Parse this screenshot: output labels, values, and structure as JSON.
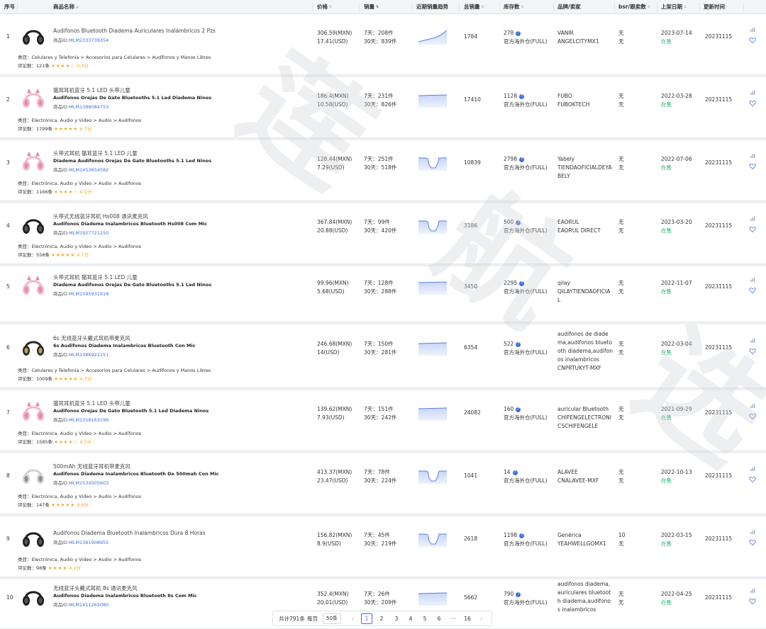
{
  "header": {
    "idx": "序号",
    "name": "商品名称",
    "price": "价格",
    "sales": "销量",
    "trend": "近期销量趋势",
    "total": "总销量",
    "stock": "库存数",
    "brand": "品牌/卖家",
    "bsr": "bsr/跟卖数",
    "date": "上架日期",
    "updated": "更新时间"
  },
  "products": [
    {
      "idx": "1",
      "title": "Audifonos Bluetooth Diadema Auriculares Inalámbricos 2 Pzs",
      "subtitle": "",
      "pid_label": "商品ID:",
      "pid": "MLM2333739354",
      "category": "类目：Celulares y Telefonía > Accesorios para Celulares > Audífonos y Manos Libres",
      "reviews": "评论数：121条",
      "stars": "★★★★☆",
      "rating": "4.4分",
      "price_mxn": "306.59(MXN)",
      "price_usd": "17.41(USD)",
      "sales7": "7天：208件",
      "sales30": "30天：839件",
      "trend": "up",
      "total": "1784",
      "stock": "278",
      "warehouse": "官方海外仓(FULL)",
      "brand1": "VANIR",
      "brand2": "ANGELCITYMX1",
      "bsr1": "无",
      "bsr2": "无",
      "date": "2023-07-14",
      "status": "在售",
      "updated": "20231115",
      "thumb": "black"
    },
    {
      "idx": "2",
      "title": "猫耳耳机蓝牙 5.1 LED 头带儿童",
      "subtitle": "Audifonos Orejas De Gato Bluetooths 5.1 Led Diadema Ninos",
      "pid_label": "商品ID:",
      "pid": "MLM1398084753",
      "category": "类目：Electrónica, Audio y Video > Audio > Audífonos",
      "reviews": "评论数：1799条",
      "stars": "★★★★★",
      "rating": "4.7分",
      "price_mxn": "186.4(MXN)",
      "price_usd": "10.58(USD)",
      "sales7": "7天：231件",
      "sales30": "30天：826件",
      "trend": "flat",
      "total": "17410",
      "stock": "1128",
      "warehouse": "官方海外仓(FULL)",
      "brand1": "FUBO",
      "brand2": "FUBOKTECH",
      "bsr1": "无",
      "bsr2": "无",
      "date": "2022-03-28",
      "status": "在售",
      "updated": "20231115",
      "thumb": "pink"
    },
    {
      "idx": "3",
      "title": "头带式耳机 猫耳蓝牙 5.1 LED 儿童",
      "subtitle": "Diadema Audifonos Orejas De Gato Bluetooths 5.1 Led Ninos",
      "pid_label": "商品ID:",
      "pid": "MLM1453654582",
      "category": "类目：Electrónica, Audio y Video > Audio > Audífonos",
      "reviews": "评论数：1166条",
      "stars": "★★★★☆",
      "rating": "4.5分",
      "price_mxn": "128.44(MXN)",
      "price_usd": "7.29(USD)",
      "sales7": "7天：251件",
      "sales30": "30天：518件",
      "trend": "dip",
      "total": "10839",
      "stock": "2798",
      "warehouse": "官方海外仓(FULL)",
      "brand1": "Yabely",
      "brand2": "TIENDAOFICIALDEYABELY",
      "bsr1": "无",
      "bsr2": "无",
      "date": "2022-07-06",
      "status": "在售",
      "updated": "20231115",
      "thumb": "pink"
    },
    {
      "idx": "4",
      "title": "头带式无线蓝牙耳机 Hs008 通讯麦克风",
      "subtitle": "Audifonos Diadema Inalambricos Bluetooth Hs008 Com Mic",
      "pid_label": "商品ID:",
      "pid": "MLM1927721250",
      "category": "类目：Electrónica, Audio y Video > Audio > Audífonos",
      "reviews": "评论数：558条",
      "stars": "★★★★★",
      "rating": "4.7分",
      "price_mxn": "367.84(MXN)",
      "price_usd": "20.88(USD)",
      "sales7": "7天：99件",
      "sales30": "30天：420件",
      "trend": "dip",
      "total": "3186",
      "stock": "500",
      "warehouse": "官方海外仓(FULL)",
      "brand1": "EAORUL",
      "brand2": "EAORUL DIRECT",
      "bsr1": "无",
      "bsr2": "无",
      "date": "2023-03-20",
      "status": "在售",
      "updated": "20231115",
      "thumb": "black"
    },
    {
      "idx": "5",
      "title": "头带式耳机 猫耳蓝牙 5.1 LED 儿童",
      "subtitle": "Diadema Audifonos Orejas De Gato Bluetooths 5.1 Led Ninos",
      "pid_label": "商品ID:",
      "pid": "MLM1595931918",
      "category": "",
      "reviews": "",
      "stars": "",
      "rating": "",
      "price_mxn": "99.96(MXN)",
      "price_usd": "5.68(USD)",
      "sales7": "7天：128件",
      "sales30": "30天：288件",
      "trend": "flat",
      "total": "3450",
      "stock": "2295",
      "warehouse": "官方海外仓(FULL)",
      "brand1": "qilay",
      "brand2": "QILAYTIENDAOFICIAL",
      "bsr1": "无",
      "bsr2": "无",
      "date": "2022-11-07",
      "status": "在售",
      "updated": "20231115",
      "thumb": "pink"
    },
    {
      "idx": "6",
      "title": "6s 无线蓝牙头戴式耳机带麦克风",
      "subtitle": "6s Audifonos Diadema Inalambricos Bluetooth Con Mic",
      "pid_label": "商品ID:",
      "pid": "MLM1386922251",
      "category": "类目：Celulares y Telefonía > Accesorios para Celulares > Audífonos y Manos Libres",
      "reviews": "评论数：1009条",
      "stars": "★★★★★",
      "rating": "4.7分",
      "price_mxn": "246.68(MXN)",
      "price_usd": "14(USD)",
      "sales7": "7天：150件",
      "sales30": "30天：281件",
      "trend": "flat",
      "total": "6354",
      "stock": "522",
      "warehouse": "官方海外仓(FULL)",
      "brand1": "audifonos de diadema,audifonos bluetooth diadema,audifonos inalambricos",
      "brand2": "CNPRTUKYT-MXF",
      "bsr1": "无",
      "bsr2": "无",
      "date": "2022-03-04",
      "status": "在售",
      "updated": "20231115",
      "thumb": "gold"
    },
    {
      "idx": "7",
      "title": "猫耳耳机蓝牙 5.1 LED 头带儿童",
      "subtitle": "Audifonos Orejas De Gato Bluetooth 5.1 Led Diadema Ninos",
      "pid_label": "商品ID:",
      "pid": "MLM1318163196",
      "category": "类目：Electrónica, Audio y Video > Audio > Audífonos",
      "reviews": "评论数：1585条",
      "stars": "★★★★☆",
      "rating": "4.5分",
      "price_mxn": "139.62(MXN)",
      "price_usd": "7.93(USD)",
      "sales7": "7天：151件",
      "sales30": "30天：242件",
      "trend": "flat",
      "total": "24082",
      "stock": "160",
      "warehouse": "官方海外仓(FULL)",
      "brand1": "auricular Bluetooth",
      "brand2": "CHIFENGELECTRONICSCHIFENGELE",
      "bsr1": "无",
      "bsr2": "无",
      "date": "2021-09-29",
      "status": "在售",
      "updated": "20231115",
      "thumb": "pink"
    },
    {
      "idx": "8",
      "title": "500mAh 无线蓝牙耳机带麦克风",
      "subtitle": "Audifonos Diadema Inalambricos Bluetooth De 500mah Con Mic",
      "pid_label": "商品ID:",
      "pid": "MLM1534505603",
      "category": "类目：Electrónica, Audio y Video > Audio > Audífonos",
      "reviews": "评论数：147条",
      "stars": "★★★★★",
      "rating": "4.8分",
      "price_mxn": "413.37(MXN)",
      "price_usd": "23.47(USD)",
      "sales7": "7天：78件",
      "sales30": "30天：224件",
      "trend": "dip",
      "total": "1041",
      "stock": "14",
      "warehouse": "官方海外仓(FULL)",
      "brand1": "ALAVEE",
      "brand2": "CNALAVEE-MXF",
      "bsr1": "无",
      "bsr2": "无",
      "date": "2022-10-13",
      "status": "在售",
      "updated": "20231115",
      "thumb": "grey"
    },
    {
      "idx": "9",
      "title": "Audifonos Diadema Bluetooth Inalámbricos Dura 8 Horas",
      "subtitle": "",
      "pid_label": "商品ID:",
      "pid": "MLM1391908955",
      "category": "类目：Electrónica, Audio y Video > Audio > Audífonos",
      "reviews": "评论数：98条",
      "stars": "★★★★",
      "rating": "4.2分",
      "price_mxn": "156.82(MXN)",
      "price_usd": "8.9(USD)",
      "sales7": "7天：45件",
      "sales30": "30天：219件",
      "trend": "dip",
      "total": "2618",
      "stock": "1198",
      "warehouse": "官方海外仓(FULL)",
      "brand1": "Genérica",
      "brand2": "YEAHWELLGOMX1",
      "bsr1": "10",
      "bsr2": "无",
      "date": "2022-03-15",
      "status": "在售",
      "updated": "20231115",
      "thumb": "black"
    },
    {
      "idx": "10",
      "title": "无线蓝牙头戴式耳机 8s 通讯麦克风",
      "subtitle": "Audifonos Diadema Inalambricos Bluetooth 8s Com Mic",
      "pid_label": "商品ID:",
      "pid": "MLM1411265080",
      "category": "",
      "reviews": "",
      "stars": "",
      "rating": "",
      "price_mxn": "352.4(MXN)",
      "price_usd": "20.01(USD)",
      "sales7": "7天：26件",
      "sales30": "30天：209件",
      "trend": "flat",
      "total": "5662",
      "stock": "790",
      "warehouse": "官方海外仓(FULL)",
      "brand1": "audifonos diadema,auriculares bluetooth diadema,audifonos inalambricos",
      "brand2": "",
      "bsr1": "无",
      "bsr2": "无",
      "date": "2022-04-25",
      "status": "在售",
      "updated": "20231115",
      "thumb": "black"
    }
  ],
  "pager": {
    "total": "共计791条",
    "per_page_label": "每页",
    "per_page": "50条",
    "pages": [
      "1",
      "2",
      "3",
      "4",
      "5",
      "6",
      "···",
      "16"
    ],
    "current": "1",
    "prev": "‹",
    "next": "›"
  },
  "colors": {
    "accent": "#4a6cf7",
    "link": "#3b6fe0",
    "status_green": "#1db36a",
    "star": "#f5a623",
    "trend_fill": "#c8d6f7",
    "trend_line": "#5b7fe8"
  }
}
